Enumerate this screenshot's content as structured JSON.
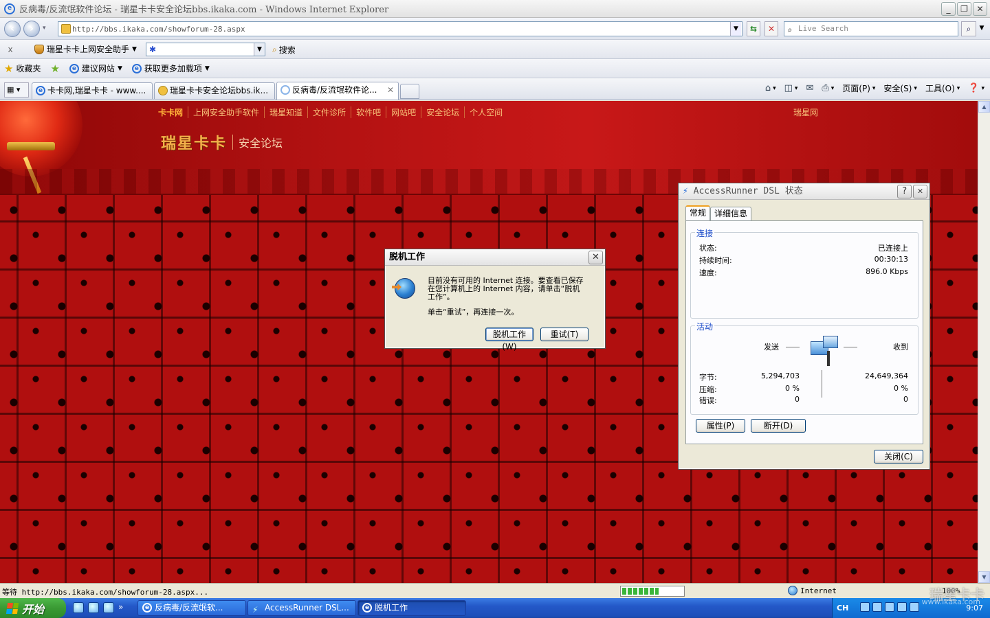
{
  "window": {
    "title": "反病毒/反流氓软件论坛 - 瑞星卡卡安全论坛bbs.ikaka.com - Windows Internet Explorer",
    "min": "_",
    "max": "❐",
    "close": "✕"
  },
  "address": {
    "url": "http://bbs.ikaka.com/showforum-28.aspx",
    "search_placeholder": "Live Search"
  },
  "addon_toolbar": {
    "close": "x",
    "assistant_label": "瑞星卡卡上网安全助手",
    "search_label": "搜索"
  },
  "favorites_bar": {
    "favorites": "收藏夹",
    "suggested_sites": "建议网站",
    "get_addons": "获取更多加载项"
  },
  "tabs": [
    {
      "label": "卡卡网,瑞星卡卡 - www...."
    },
    {
      "label": "瑞星卡卡安全论坛bbs.ik..."
    },
    {
      "label": "反病毒/反流氓软件论...",
      "close": "✕"
    }
  ],
  "commands": {
    "page": "页面(P)",
    "safety": "安全(S)",
    "tools": "工具(O)"
  },
  "site": {
    "nav": [
      "卡卡网",
      "上网安全助手软件",
      "瑞星知道",
      "文件诊所",
      "软件吧",
      "网站吧",
      "安全论坛",
      "个人空间"
    ],
    "ruixing": "瑞星网",
    "brand": "瑞星卡卡",
    "subtitle": "安全论坛"
  },
  "offline_dialog": {
    "title": "脱机工作",
    "message1": "目前没有可用的 Internet 连接。要查看已保存在您计算机上的 Internet 内容，请单击“脱机工作”。",
    "message2": "单击“重试”，再连接一次。",
    "work_offline": "脱机工作(W)",
    "retry": "重试(T)"
  },
  "dsl_dialog": {
    "title": "AccessRunner DSL 状态",
    "tab_general": "常规",
    "tab_details": "详细信息",
    "connection_group": "连接",
    "status_label": "状态:",
    "status_value": "已连接上",
    "duration_label": "持续时间:",
    "duration_value": "00:30:13",
    "speed_label": "速度:",
    "speed_value": "896.0 Kbps",
    "activity_group": "活动",
    "sent": "发送",
    "received": "收到",
    "bytes_label": "字节:",
    "bytes_sent": "5,294,703",
    "bytes_received": "24,649,364",
    "compression_label": "压缩:",
    "compression_sent": "0 %",
    "compression_received": "0 %",
    "errors_label": "错误:",
    "errors_sent": "0",
    "errors_received": "0",
    "properties": "属性(P)",
    "disconnect": "断开(D)",
    "close": "关闭(C)"
  },
  "statusbar": {
    "text": "等待 http://bbs.ikaka.com/showforum-28.aspx...",
    "progress": 0.6,
    "zone": "Internet",
    "zoom": "100%"
  },
  "taskbar": {
    "start": "开始",
    "tasks": [
      {
        "label": "反病毒/反流氓软..."
      },
      {
        "label": "AccessRunner DSL..."
      },
      {
        "label": "脱机工作"
      }
    ],
    "lang": "CH",
    "time": "9:07",
    "watermark": "瑞星卡卡",
    "watermark_url": "www.ikaka.com"
  }
}
